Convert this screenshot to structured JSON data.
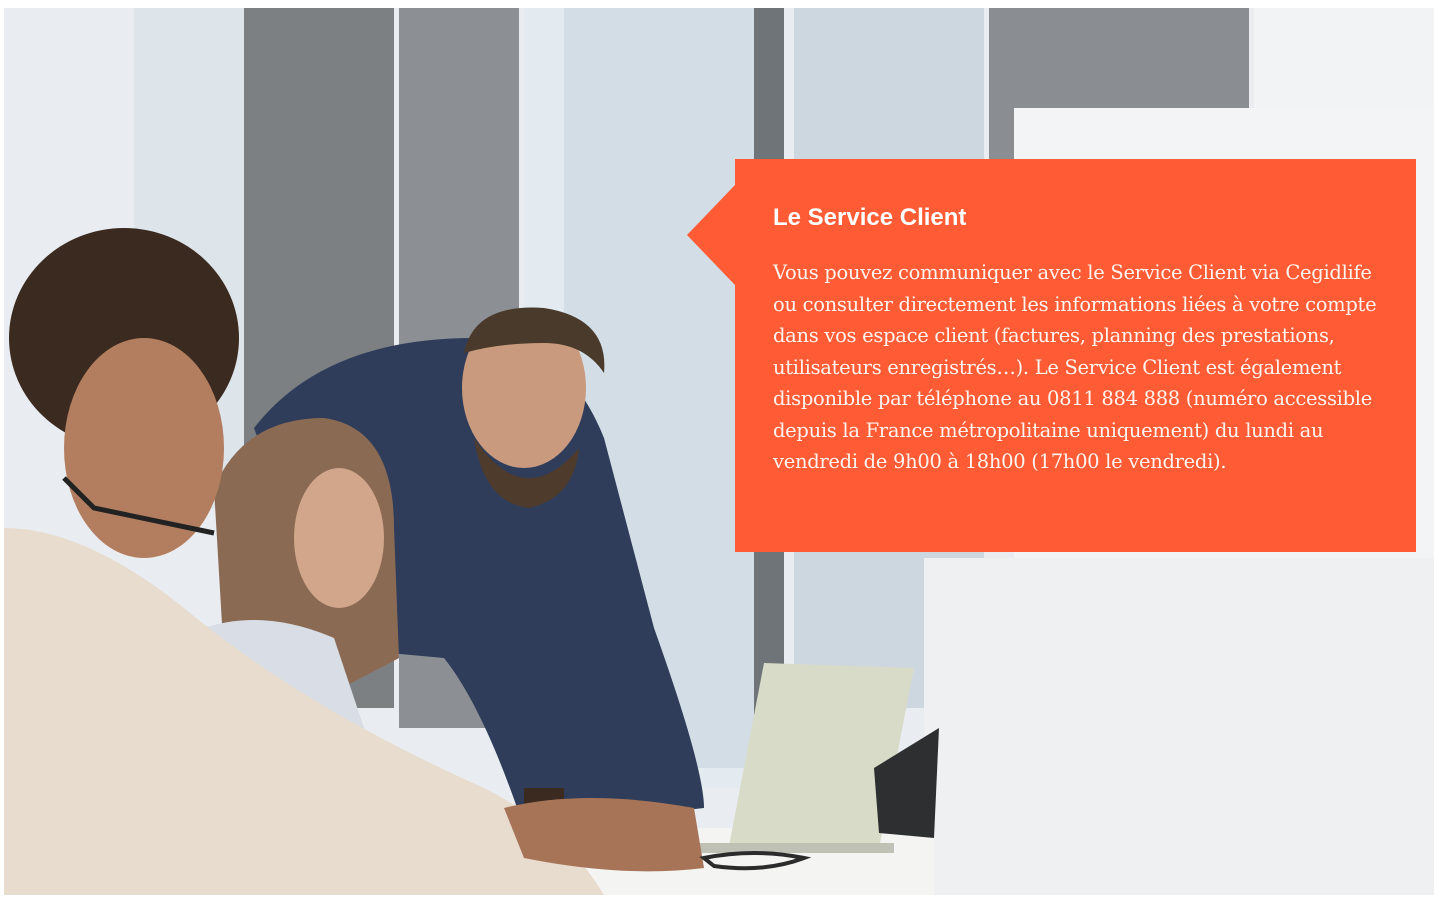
{
  "photo": {
    "alt_icon": "photo-office-customer-service-team"
  },
  "callout": {
    "title": "Le Service Client",
    "body": "Vous pouvez communiquer avec le Service Client via Cegidlife ou consulter directement les informations liées à votre compte dans vos espace client (factures, planning des prestations, utilisateurs enregistrés…). Le Service Client est également disponible par téléphone au 0811 884 888 (numéro accessible depuis la France métropolitaine uniquement) du lundi au vendredi de 9h00 à 18h00 (17h00 le vendredi).",
    "background_color": "#ff5c35",
    "text_color": "#ffffff"
  }
}
